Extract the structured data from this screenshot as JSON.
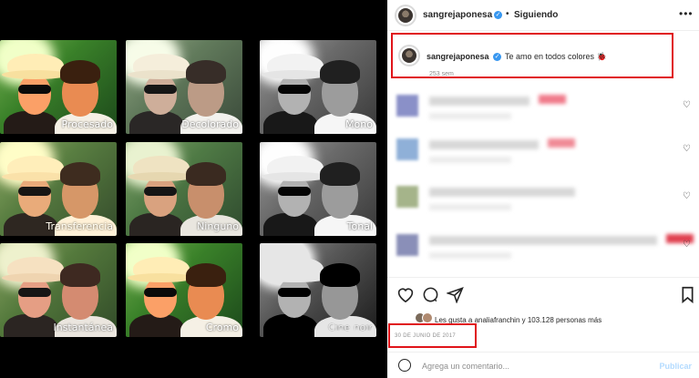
{
  "filters": [
    {
      "label": "Procesado",
      "style": "vivid"
    },
    {
      "label": "Decolorado",
      "style": "faded"
    },
    {
      "label": "Mono",
      "style": "grey"
    },
    {
      "label": "Transferencia",
      "style": "warm"
    },
    {
      "label": "Ninguno",
      "style": "none"
    },
    {
      "label": "Tonal",
      "style": "grey"
    },
    {
      "label": "Instantánea",
      "style": "cool"
    },
    {
      "label": "Cromo",
      "style": "vivid"
    },
    {
      "label": "Cine noir",
      "style": "noir"
    }
  ],
  "header": {
    "username": "sangrejaponesa",
    "separator": "•",
    "follow_status": "Siguiendo",
    "more_icon": "more-icon"
  },
  "caption": {
    "username": "sangrejaponesa",
    "text": "Te amo en todos colores 🐞",
    "time_ago": "253 sem"
  },
  "comments_count": 4,
  "actions": {
    "like_icon": "heart-icon",
    "comment_icon": "comment-icon",
    "share_icon": "share-icon",
    "save_icon": "bookmark-icon"
  },
  "likes": {
    "text": "Les gusta a analiafranchin y 103.128 personas más"
  },
  "date": "30 DE JUNIO DE 2017",
  "add_comment": {
    "placeholder": "Agrega un comentario...",
    "publish_label": "Publicar"
  },
  "colors": {
    "highlight": "#e0141a",
    "verified": "#3897f0",
    "publish": "#b3dbff"
  }
}
